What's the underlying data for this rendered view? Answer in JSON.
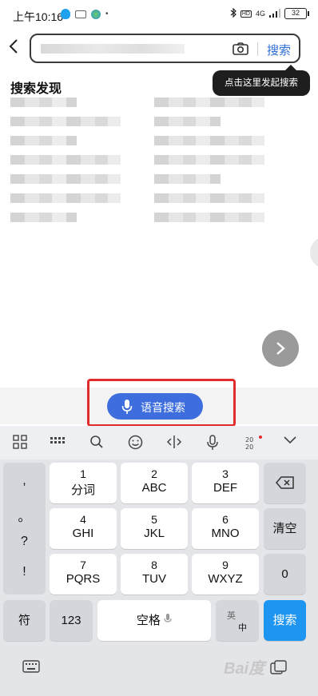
{
  "status_bar": {
    "time": "上午10:16",
    "battery": "32",
    "network": "4G"
  },
  "search": {
    "button_label": "搜索"
  },
  "tooltip": {
    "text": "点击这里发起搜索"
  },
  "discover": {
    "title": "搜索发现"
  },
  "voice": {
    "label": "语音搜索"
  },
  "keyboard": {
    "punct": [
      ",",
      "。",
      "?",
      "!"
    ],
    "keys": [
      {
        "num": "1",
        "letters": "分词"
      },
      {
        "num": "2",
        "letters": "ABC"
      },
      {
        "num": "3",
        "letters": "DEF"
      },
      {
        "num": "4",
        "letters": "GHI"
      },
      {
        "num": "5",
        "letters": "JKL"
      },
      {
        "num": "6",
        "letters": "MNO"
      },
      {
        "num": "7",
        "letters": "PQRS"
      },
      {
        "num": "8",
        "letters": "TUV"
      },
      {
        "num": "9",
        "letters": "WXYZ"
      }
    ],
    "clear": "清空",
    "zero": "0",
    "symbol": "符",
    "num123": "123",
    "space": "空格",
    "lang_top": "英",
    "lang_bottom": "中",
    "search": "搜索"
  },
  "watermark": "Bai度"
}
